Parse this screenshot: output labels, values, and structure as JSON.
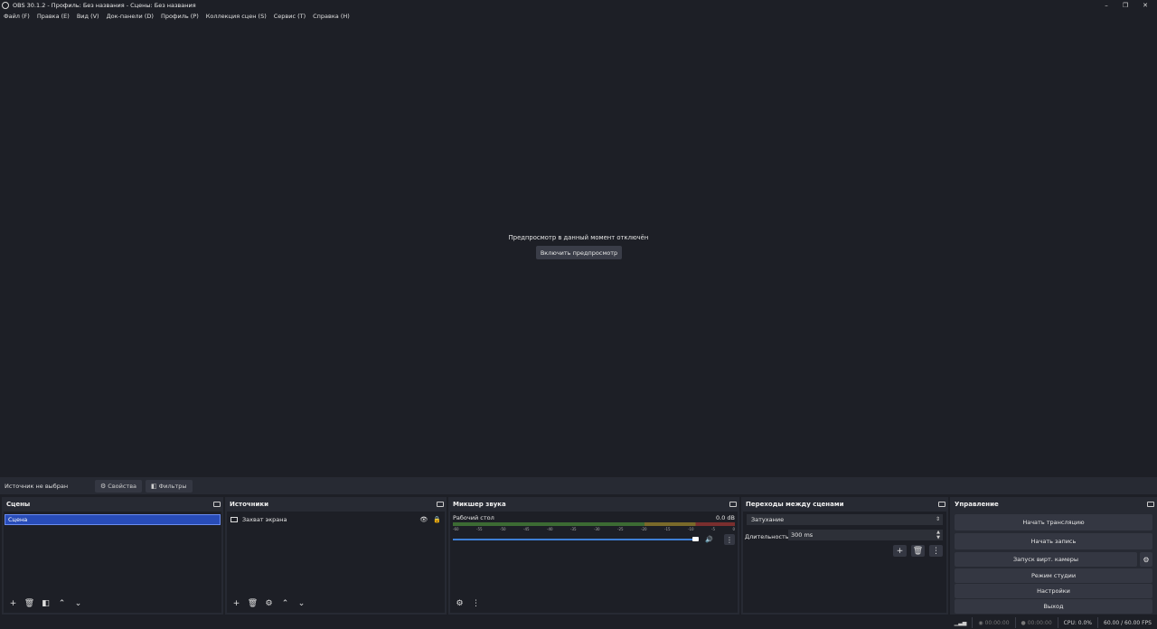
{
  "window": {
    "title": "OBS 30.1.2 - Профиль: Без названия - Сцены: Без названия",
    "controls": [
      "–",
      "❐",
      "✕"
    ]
  },
  "menu": [
    "Файл (F)",
    "Правка (E)",
    "Вид (V)",
    "Док-панели (D)",
    "Профиль (P)",
    "Коллекция сцен (S)",
    "Сервис (T)",
    "Справка (H)"
  ],
  "preview": {
    "message": "Предпросмотр в данный момент отключён",
    "enable_button": "Включить предпросмотр"
  },
  "source_bar": {
    "no_source": "Источник не выбран",
    "properties_button": "Свойства",
    "filters_button": "Фильтры"
  },
  "scenes": {
    "title": "Сцены",
    "items": [
      "Сцена"
    ]
  },
  "sources": {
    "title": "Источники",
    "items": [
      "Захват экрана"
    ]
  },
  "mixer": {
    "title": "Микшер звука",
    "channel": "Рабочий стол",
    "level": "0.0 dB",
    "ticks": [
      "-60",
      "-55",
      "-50",
      "-45",
      "-40",
      "-35",
      "-30",
      "-25",
      "-20",
      "-15",
      "-10",
      "-5",
      "0"
    ],
    "volume_fraction": 1.0
  },
  "transitions": {
    "title": "Переходы между сценами",
    "selected": "Затухание",
    "duration_label": "Длительность",
    "duration_value": "300 ms"
  },
  "controls": {
    "title": "Управление",
    "start_stream": "Начать трансляцию",
    "start_record": "Начать запись",
    "virtual_camera": "Запуск вирт. камеры",
    "studio_mode": "Режим студии",
    "settings": "Настройки",
    "exit": "Выход"
  },
  "status": {
    "stream_time": "00:00:00",
    "record_time": "00:00:00",
    "cpu": "CPU: 0.0%",
    "fps": "60.00 / 60.00 FPS"
  }
}
